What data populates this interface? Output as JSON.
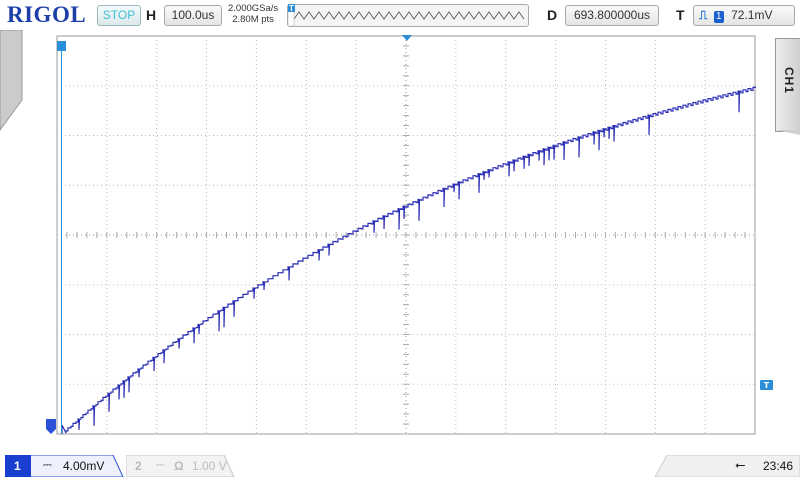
{
  "header": {
    "logo": "RIGOL",
    "run_state": "STOP",
    "timebase_label": "H",
    "timebase_value": "100.0us",
    "sample_rate": "2.000GSa/s",
    "memory_depth": "2.80M pts",
    "delay_label": "D",
    "delay_value": "693.800000us",
    "trigger_label": "T",
    "trigger_source": "1",
    "trigger_level": "72.1mV"
  },
  "channel_tab": {
    "label": "CH1"
  },
  "footer": {
    "ch1_number": "1",
    "ch1_scale": "4.00mV",
    "ch2_number": "2",
    "ch2_coupling_symbol": "Ω",
    "ch2_scale": "1.00 V",
    "clock": "23:46"
  },
  "colors": {
    "trace": "#2b2fb5",
    "accent": "#2a8fd8",
    "logo": "#1c3fa8",
    "stop": "#3fbfd6"
  }
}
